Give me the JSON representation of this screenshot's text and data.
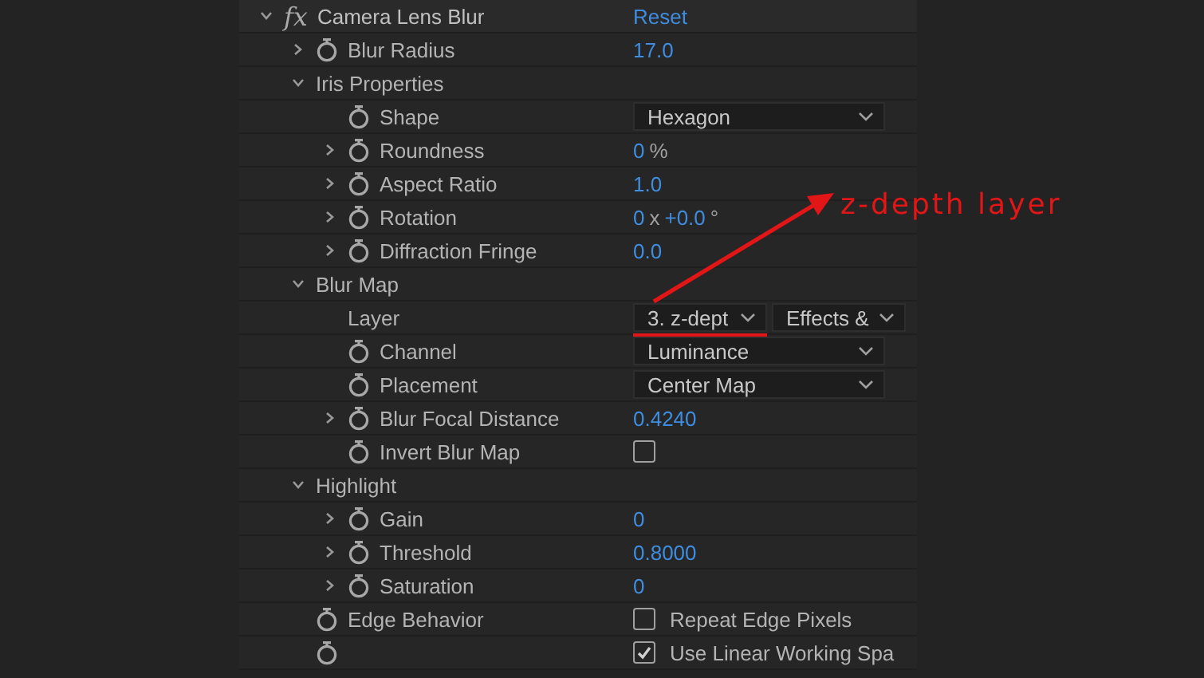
{
  "effect": {
    "icon_text": "fx",
    "name": "Camera Lens Blur",
    "expanded": true,
    "reset": "Reset",
    "properties": [
      {
        "kind": "property",
        "name": "Blur Radius",
        "stopwatch": true,
        "expanded": false,
        "value": [
          {
            "kind": "number",
            "text": "17.0"
          }
        ]
      },
      {
        "kind": "group",
        "name": "Iris Properties",
        "expanded": true,
        "children": [
          {
            "kind": "property",
            "name": "Shape",
            "stopwatch": true,
            "value": [
              {
                "kind": "dropdown",
                "text": "Hexagon"
              }
            ]
          },
          {
            "kind": "property",
            "name": "Roundness",
            "stopwatch": true,
            "expanded": false,
            "value": [
              {
                "kind": "number",
                "text": "0"
              },
              {
                "kind": "unit",
                "text": "%"
              }
            ]
          },
          {
            "kind": "property",
            "name": "Aspect Ratio",
            "stopwatch": true,
            "expanded": false,
            "value": [
              {
                "kind": "number",
                "text": "1.0"
              }
            ]
          },
          {
            "kind": "property",
            "name": "Rotation",
            "stopwatch": true,
            "expanded": false,
            "value": [
              {
                "kind": "number",
                "text": "0"
              },
              {
                "kind": "unit",
                "text": "x"
              },
              {
                "kind": "number",
                "text": "+0.0"
              },
              {
                "kind": "unit",
                "text": "°"
              }
            ]
          },
          {
            "kind": "property",
            "name": "Diffraction Fringe",
            "stopwatch": true,
            "expanded": false,
            "value": [
              {
                "kind": "number",
                "text": "0.0"
              }
            ]
          }
        ]
      },
      {
        "kind": "group",
        "name": "Blur Map",
        "expanded": true,
        "children": [
          {
            "kind": "property",
            "name": "Layer",
            "stopwatch": false,
            "value": [
              {
                "kind": "dropdown",
                "text": "3. z-dept",
                "marked": true
              },
              {
                "kind": "dropdown",
                "text": "Effects &"
              }
            ]
          },
          {
            "kind": "property",
            "name": "Channel",
            "stopwatch": true,
            "value": [
              {
                "kind": "dropdown",
                "text": "Luminance"
              }
            ]
          },
          {
            "kind": "property",
            "name": "Placement",
            "stopwatch": true,
            "value": [
              {
                "kind": "dropdown",
                "text": "Center Map"
              }
            ]
          },
          {
            "kind": "property",
            "name": "Blur Focal Distance",
            "stopwatch": true,
            "expanded": false,
            "value": [
              {
                "kind": "number",
                "text": "0.4240"
              }
            ]
          },
          {
            "kind": "property",
            "name": "Invert Blur Map",
            "stopwatch": true,
            "value": [
              {
                "kind": "checkbox",
                "checked": false
              }
            ]
          }
        ]
      },
      {
        "kind": "group",
        "name": "Highlight",
        "expanded": true,
        "children": [
          {
            "kind": "property",
            "name": "Gain",
            "stopwatch": true,
            "expanded": false,
            "value": [
              {
                "kind": "number",
                "text": "0"
              }
            ]
          },
          {
            "kind": "property",
            "name": "Threshold",
            "stopwatch": true,
            "expanded": false,
            "value": [
              {
                "kind": "number",
                "text": "0.8000"
              }
            ]
          },
          {
            "kind": "property",
            "name": "Saturation",
            "stopwatch": true,
            "expanded": false,
            "value": [
              {
                "kind": "number",
                "text": "0"
              }
            ]
          }
        ]
      },
      {
        "kind": "property",
        "name": "Edge Behavior",
        "stopwatch": true,
        "value": [
          {
            "kind": "checkbox",
            "checked": false,
            "text": "Repeat Edge Pixels"
          }
        ]
      },
      {
        "kind": "property",
        "stopwatch": true,
        "value": [
          {
            "kind": "checkbox",
            "checked": true,
            "text": "Use Linear Working Spa"
          }
        ]
      }
    ]
  },
  "annotation": {
    "label": "z-depth layer"
  }
}
